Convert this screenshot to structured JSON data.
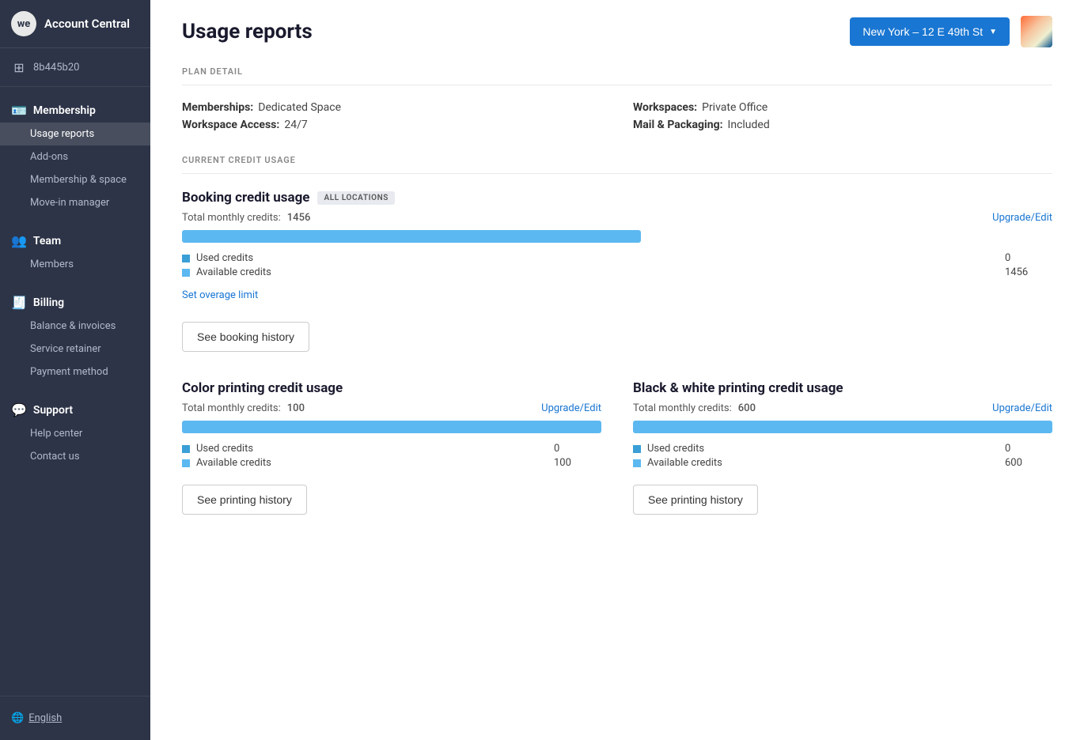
{
  "sidebar": {
    "logo_text": "we",
    "app_title": "Account Central",
    "account_id": "8b445b20",
    "sections": [
      {
        "id": "membership",
        "icon": "🪪",
        "label": "Membership",
        "items": [
          {
            "id": "usage-reports",
            "label": "Usage reports",
            "active": true
          },
          {
            "id": "add-ons",
            "label": "Add-ons"
          },
          {
            "id": "membership-space",
            "label": "Membership & space"
          },
          {
            "id": "move-in-manager",
            "label": "Move-in manager"
          }
        ]
      },
      {
        "id": "team",
        "icon": "👥",
        "label": "Team",
        "items": [
          {
            "id": "members",
            "label": "Members"
          }
        ]
      },
      {
        "id": "billing",
        "icon": "🧾",
        "label": "Billing",
        "items": [
          {
            "id": "balance-invoices",
            "label": "Balance & invoices"
          },
          {
            "id": "service-retainer",
            "label": "Service retainer"
          },
          {
            "id": "payment-method",
            "label": "Payment method"
          }
        ]
      },
      {
        "id": "support",
        "icon": "💬",
        "label": "Support",
        "items": [
          {
            "id": "help-center",
            "label": "Help center"
          },
          {
            "id": "contact-us",
            "label": "Contact us"
          }
        ]
      }
    ],
    "footer_language": "English"
  },
  "header": {
    "page_title": "Usage reports",
    "location_btn": "New York – 12 E 49th St"
  },
  "plan_detail": {
    "section_label": "PLAN DETAIL",
    "rows": [
      {
        "label": "Memberships:",
        "value": "Dedicated Space"
      },
      {
        "label": "Workspaces:",
        "value": "Private Office"
      },
      {
        "label": "Workspace Access:",
        "value": "24/7"
      },
      {
        "label": "Mail & Packaging:",
        "value": "Included"
      }
    ]
  },
  "current_credit_usage": {
    "section_label": "CURRENT CREDIT USAGE",
    "booking": {
      "title": "Booking credit usage",
      "badge": "ALL LOCATIONS",
      "total_label": "Total monthly credits:",
      "total_value": "1456",
      "upgrade_label": "Upgrade/Edit",
      "used_credits_label": "Used credits",
      "used_credits_value": "0",
      "available_credits_label": "Available credits",
      "available_credits_value": "1456",
      "progress_used_pct": 0,
      "overage_link": "Set overage limit",
      "history_btn": "See booking history"
    },
    "color_printing": {
      "title": "Color printing credit usage",
      "total_label": "Total monthly credits:",
      "total_value": "100",
      "upgrade_label": "Upgrade/Edit",
      "used_credits_label": "Used credits",
      "used_credits_value": "0",
      "available_credits_label": "Available credits",
      "available_credits_value": "100",
      "progress_used_pct": 0,
      "history_btn": "See printing history"
    },
    "bw_printing": {
      "title": "Black & white printing credit usage",
      "total_label": "Total monthly credits:",
      "total_value": "600",
      "upgrade_label": "Upgrade/Edit",
      "used_credits_label": "Used credits",
      "used_credits_value": "0",
      "available_credits_label": "Available credits",
      "available_credits_value": "600",
      "progress_used_pct": 0,
      "history_btn": "See printing history"
    }
  }
}
